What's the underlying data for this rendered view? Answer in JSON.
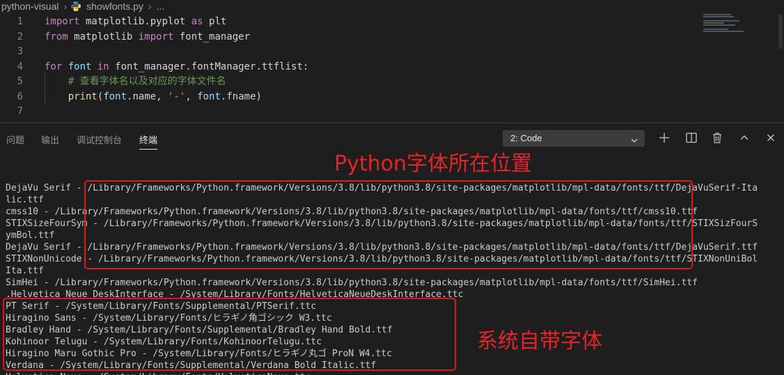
{
  "breadcrumb": {
    "project": "python-visual",
    "file": "showfonts.py",
    "more": "..."
  },
  "editor": {
    "lines": [
      {
        "num": "1",
        "tokens": [
          [
            "kw2",
            "import"
          ],
          [
            "plain",
            " matplotlib.pyplot "
          ],
          [
            "kw2",
            "as"
          ],
          [
            "plain",
            " plt"
          ]
        ]
      },
      {
        "num": "2",
        "tokens": [
          [
            "kw2",
            "from"
          ],
          [
            "plain",
            " matplotlib "
          ],
          [
            "kw2",
            "import"
          ],
          [
            "plain",
            " font_manager"
          ]
        ]
      },
      {
        "num": "3",
        "tokens": []
      },
      {
        "num": "4",
        "tokens": [
          [
            "kw2",
            "for"
          ],
          [
            "var",
            " font "
          ],
          [
            "kw2",
            "in"
          ],
          [
            "plain",
            " font_manager.fontManager.ttflist:"
          ]
        ]
      },
      {
        "num": "5",
        "tokens": [
          [
            "plain",
            "    "
          ],
          [
            "cmt",
            "# 查看字体名以及对应的字体文件名"
          ]
        ]
      },
      {
        "num": "6",
        "tokens": [
          [
            "plain",
            "    "
          ],
          [
            "fn",
            "print"
          ],
          [
            "plain",
            "("
          ],
          [
            "var",
            "font"
          ],
          [
            "plain",
            ".name, "
          ],
          [
            "str",
            "'-'"
          ],
          [
            "plain",
            ", "
          ],
          [
            "var",
            "font"
          ],
          [
            "plain",
            ".fname)"
          ]
        ]
      },
      {
        "num": "7",
        "tokens": []
      }
    ]
  },
  "panel": {
    "tabs": [
      {
        "label": "问题",
        "active": false
      },
      {
        "label": "输出",
        "active": false
      },
      {
        "label": "调试控制台",
        "active": false
      },
      {
        "label": "终端",
        "active": true
      }
    ],
    "terminal_select": "2: Code",
    "icons": [
      "plus-icon",
      "split-icon",
      "trash-icon",
      "chevron-up-icon",
      "close-icon"
    ]
  },
  "terminal": {
    "lines": [
      "DejaVu Serif - /Library/Frameworks/Python.framework/Versions/3.8/lib/python3.8/site-packages/matplotlib/mpl-data/fonts/ttf/DejaVuSerif-Ita",
      "lic.ttf",
      "cmss10 - /Library/Frameworks/Python.framework/Versions/3.8/lib/python3.8/site-packages/matplotlib/mpl-data/fonts/ttf/cmss10.ttf",
      "STIXSizeFourSym - /Library/Frameworks/Python.framework/Versions/3.8/lib/python3.8/site-packages/matplotlib/mpl-data/fonts/ttf/STIXSizFourS",
      "ymBol.ttf",
      "DejaVu Serif - /Library/Frameworks/Python.framework/Versions/3.8/lib/python3.8/site-packages/matplotlib/mpl-data/fonts/ttf/DejaVuSerif.ttf",
      "STIXNonUnicode - /Library/Frameworks/Python.framework/Versions/3.8/lib/python3.8/site-packages/matplotlib/mpl-data/fonts/ttf/STIXNonUniBol",
      "Ita.ttf",
      "SimHei - /Library/Frameworks/Python.framework/Versions/3.8/lib/python3.8/site-packages/matplotlib/mpl-data/fonts/ttf/SimHei.ttf",
      ".Helvetica Neue DeskInterface - /System/Library/Fonts/HelveticaNeueDeskInterface.ttc",
      "PT Serif - /System/Library/Fonts/Supplemental/PTSerif.ttc",
      "Hiragino Sans - /System/Library/Fonts/ヒラギノ角ゴシック W3.ttc",
      "Bradley Hand - /System/Library/Fonts/Supplemental/Bradley Hand Bold.ttf",
      "Kohinoor Telugu - /System/Library/Fonts/KohinoorTelugu.ttc",
      "Hiragino Maru Gothic Pro - /System/Library/Fonts/ヒラギノ丸ゴ ProN W4.ttc",
      "Verdana - /System/Library/Fonts/Supplemental/Verdana Bold Italic.ttf",
      "Helvetica Neue - /System/Library/Fonts/HelveticaNeue.ttc"
    ]
  },
  "annotations": {
    "python_fonts_label": "Python字体所在位置",
    "system_fonts_label": "系统自带字体",
    "color": "#e0161f"
  }
}
